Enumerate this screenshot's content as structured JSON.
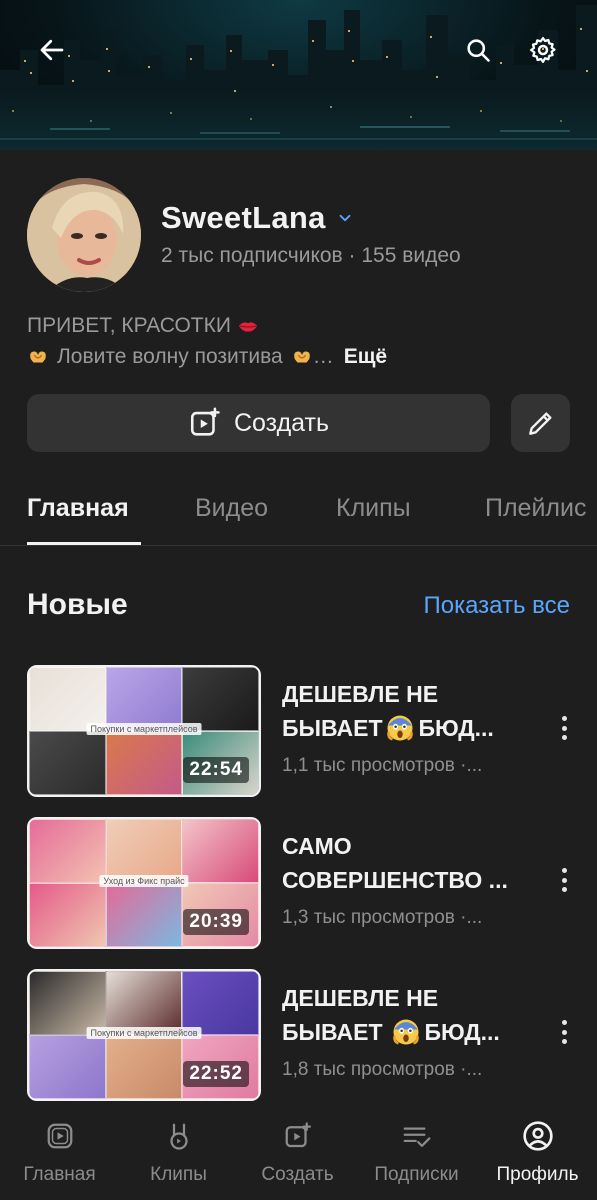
{
  "header": {
    "back_icon": "arrow-left-icon",
    "search_icon": "search-icon",
    "settings_icon": "gear-icon"
  },
  "channel": {
    "name": "SweetLana",
    "stats": "2 тыс подписчиков · 155 видео",
    "description_line1": "ПРИВЕТ, КРАСОТКИ",
    "description_line2": "Ловите волну позитива",
    "more_label": "Ещё"
  },
  "actions": {
    "create_label": "Создать",
    "edit_icon": "pencil-icon"
  },
  "tabs": [
    {
      "label": "Главная",
      "active": true
    },
    {
      "label": "Видео",
      "active": false
    },
    {
      "label": "Клипы",
      "active": false
    },
    {
      "label": "Плейлис",
      "active": false
    }
  ],
  "section": {
    "title": "Новые",
    "show_all": "Показать все"
  },
  "videos": [
    {
      "title_line1": "ДЕШЕВЛЕ НЕ",
      "title_line2_prefix": "БЫВАЕТ",
      "title_line2_suffix": "БЮД...",
      "views": "1,1 тыс просмотров ·...",
      "duration": "22:54",
      "thumb_caption": "Покупки с маркетплейсов"
    },
    {
      "title_line1": "САМО",
      "title_line2_prefix": "СОВЕРШЕНСТВО ...",
      "title_line2_suffix": "",
      "views": "1,3 тыс просмотров ·...",
      "duration": "20:39",
      "thumb_caption": "Уход из Фикс прайс"
    },
    {
      "title_line1": "ДЕШЕВЛЕ НЕ",
      "title_line2_prefix": "БЫВАЕТ",
      "title_line2_suffix": "БЮД...",
      "views": "1,8 тыс просмотров ·...",
      "duration": "22:52",
      "thumb_caption": "Покупки с маркетплейсов"
    }
  ],
  "bottom_nav": [
    {
      "label": "Главная",
      "icon": "home-play-icon",
      "active": false
    },
    {
      "label": "Клипы",
      "icon": "clips-icon",
      "active": false
    },
    {
      "label": "Создать",
      "icon": "create-icon",
      "active": false
    },
    {
      "label": "Подписки",
      "icon": "subscriptions-icon",
      "active": false
    },
    {
      "label": "Профиль",
      "icon": "profile-icon",
      "active": true
    }
  ],
  "colors": {
    "background": "#1e1e1e",
    "accent_link": "#5aa6ff",
    "button_bg": "#333333"
  }
}
